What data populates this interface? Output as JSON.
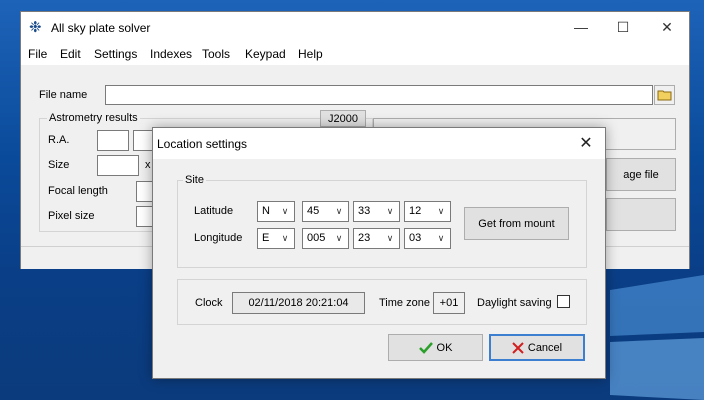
{
  "main_window": {
    "title": "All sky plate solver",
    "menu": [
      "File",
      "Edit",
      "Settings",
      "Indexes",
      "Tools",
      "Keypad",
      "Help"
    ],
    "file_name_label": "File name",
    "astrometry_group_label": "Astrometry results",
    "j2000_button": "J2000",
    "ra_label": "R.A.",
    "size_label": "Size",
    "size_x": "x",
    "focal_length_label": "Focal length",
    "pixel_size_label": "Pixel size",
    "image_file_button_partial": "age file"
  },
  "dialog": {
    "title": "Location settings",
    "site_group_label": "Site",
    "latitude_label": "Latitude",
    "latitude_hemisphere": "N",
    "latitude_deg": "45",
    "latitude_min": "33",
    "latitude_sec": "12",
    "longitude_label": "Longitude",
    "longitude_hemisphere": "E",
    "longitude_deg": "005",
    "longitude_min": "23",
    "longitude_sec": "03",
    "get_from_mount_button": "Get from mount",
    "clock_label": "Clock",
    "clock_value": "02/11/2018 20:21:04",
    "timezone_label": "Time zone",
    "timezone_value": "+01",
    "daylight_saving_label": "Daylight saving",
    "daylight_saving_checked": false,
    "ok_button": "OK",
    "cancel_button": "Cancel"
  },
  "colors": {
    "ok_check": "#2aa02a",
    "cancel_x": "#d02020",
    "focus_border": "#3c7fd1"
  }
}
